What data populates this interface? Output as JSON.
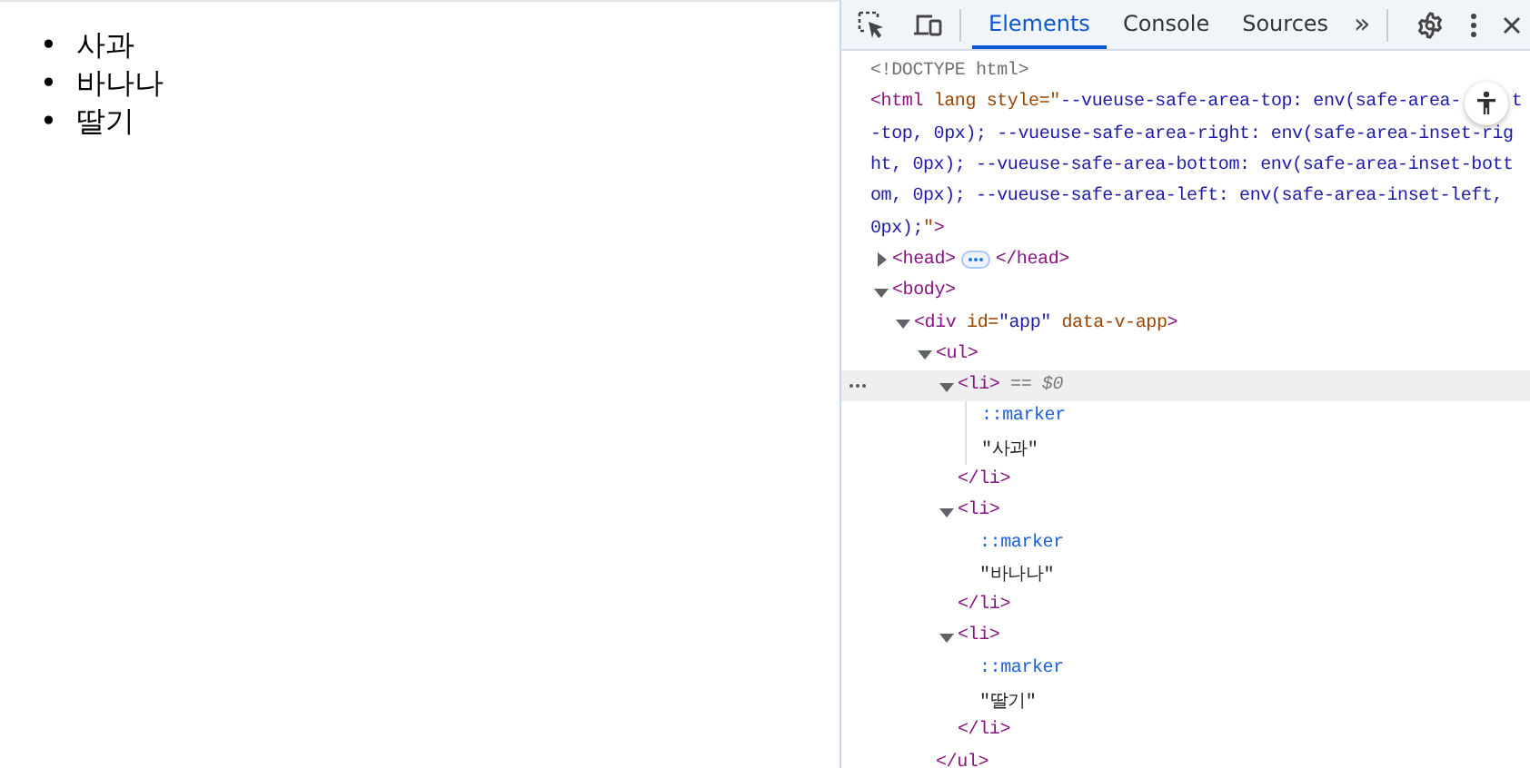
{
  "page": {
    "list_items": [
      {
        "marker": "•",
        "text": "사과"
      },
      {
        "marker": "•",
        "text": "바나나"
      },
      {
        "marker": "•",
        "text": "딸기"
      }
    ]
  },
  "devtools": {
    "tabs": [
      {
        "label": "Elements",
        "selected": true
      },
      {
        "label": "Console",
        "selected": false
      },
      {
        "label": "Sources",
        "selected": false
      }
    ],
    "more_tabs": "»",
    "tree": [
      {
        "lines": [
          [
            {
              "kind": "comment",
              "text": "<!DOCTYPE html>"
            }
          ]
        ]
      },
      {
        "lines": [
          [
            {
              "kind": "tag",
              "text": "<html"
            },
            {
              "kind": "attr",
              "text": " lang style"
            },
            {
              "kind": "attr",
              "text": "=\""
            },
            {
              "kind": "val",
              "text": "--vueuse-safe-area-top: env(safe-area-"
            },
            {
              "kind": "a11y"
            },
            {
              "kind": "val",
              "text": "t"
            }
          ],
          [
            {
              "kind": "val",
              "text": "-top, 0px); --vueuse-safe-area-right: env(safe-area-inset-rig"
            }
          ],
          [
            {
              "kind": "val",
              "text": "ht, 0px); --vueuse-safe-area-bottom: env(safe-area-inset-bott"
            }
          ],
          [
            {
              "kind": "val",
              "text": "om, 0px); --vueuse-safe-area-left: env(safe-area-inset-left,"
            }
          ],
          [
            {
              "kind": "val",
              "text": "0px);"
            },
            {
              "kind": "attr",
              "text": "\""
            },
            {
              "kind": "tag",
              "text": ">"
            }
          ]
        ],
        "children": [
          {
            "expanded": false,
            "lines": [
              [
                {
                  "kind": "tag",
                  "text": "<head>"
                },
                {
                  "kind": "ellipsis"
                },
                {
                  "kind": "tag",
                  "text": "</head>"
                }
              ]
            ]
          },
          {
            "expanded": true,
            "lines": [
              [
                {
                  "kind": "tag",
                  "text": "<body>"
                }
              ]
            ],
            "children": [
              {
                "expanded": true,
                "lines": [
                  [
                    {
                      "kind": "tag",
                      "text": "<div"
                    },
                    {
                      "kind": "attr",
                      "text": " id="
                    },
                    {
                      "kind": "val",
                      "text": "\"app\""
                    },
                    {
                      "kind": "attr",
                      "text": " data-v-app"
                    },
                    {
                      "kind": "tag",
                      "text": ">"
                    }
                  ]
                ],
                "children": [
                  {
                    "expanded": true,
                    "lines": [
                      [
                        {
                          "kind": "tag",
                          "text": "<ul>"
                        }
                      ]
                    ],
                    "children": [
                      {
                        "expanded": true,
                        "selected": true,
                        "lines": [
                          [
                            {
                              "kind": "tag",
                              "text": "<li>"
                            },
                            {
                              "kind": "dim",
                              "text": " == $0"
                            }
                          ]
                        ],
                        "children": [
                          {
                            "lines": [
                              [
                                {
                                  "kind": "pseudo",
                                  "text": "::marker"
                                }
                              ]
                            ]
                          },
                          {
                            "lines": [
                              [
                                {
                                  "kind": "text",
                                  "text": "\"사과\""
                                }
                              ]
                            ]
                          }
                        ],
                        "close": [
                          {
                            "kind": "tag",
                            "text": "</li>"
                          }
                        ]
                      },
                      {
                        "expanded": true,
                        "selected": false,
                        "lines": [
                          [
                            {
                              "kind": "tag",
                              "text": "<li>"
                            }
                          ]
                        ],
                        "children": [
                          {
                            "lines": [
                              [
                                {
                                  "kind": "pseudo",
                                  "text": "::marker"
                                }
                              ]
                            ]
                          },
                          {
                            "lines": [
                              [
                                {
                                  "kind": "text",
                                  "text": "\"바나나\""
                                }
                              ]
                            ]
                          }
                        ],
                        "close": [
                          {
                            "kind": "tag",
                            "text": "</li>"
                          }
                        ]
                      },
                      {
                        "expanded": true,
                        "selected": false,
                        "lines": [
                          [
                            {
                              "kind": "tag",
                              "text": "<li>"
                            }
                          ]
                        ],
                        "children": [
                          {
                            "lines": [
                              [
                                {
                                  "kind": "pseudo",
                                  "text": "::marker"
                                }
                              ]
                            ]
                          },
                          {
                            "lines": [
                              [
                                {
                                  "kind": "text",
                                  "text": "\"딸기\""
                                }
                              ]
                            ]
                          }
                        ],
                        "close": [
                          {
                            "kind": "tag",
                            "text": "</li>"
                          }
                        ]
                      }
                    ],
                    "close": [
                      {
                        "kind": "tag",
                        "text": "</ul>"
                      }
                    ]
                  }
                ]
              }
            ]
          }
        ]
      }
    ]
  }
}
